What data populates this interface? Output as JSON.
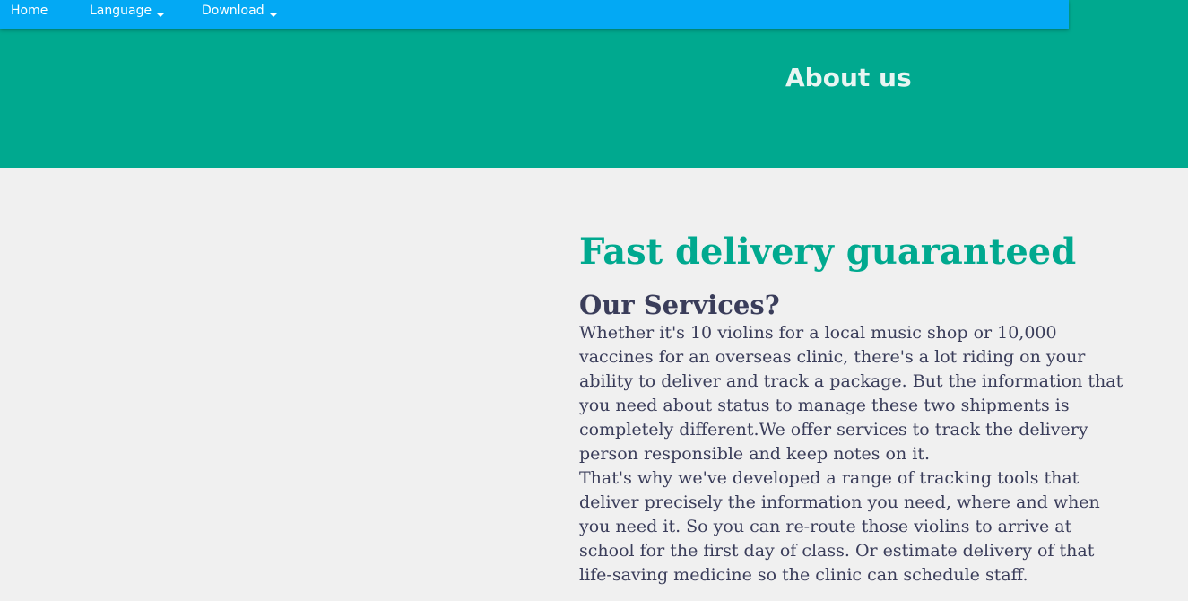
{
  "nav": {
    "home_label": "Home",
    "language_label": "Language",
    "download_label": "Download"
  },
  "hero": {
    "title": "About us"
  },
  "main": {
    "headline": "Fast delivery guaranteed",
    "subheading": "Our Services?",
    "paragraph_1": "Whether it's 10 violins for a local music shop or 10,000 vaccines for an overseas clinic, there's a lot riding on your ability to deliver and track a package. But the information that you need about status to manage these two shipments is completely different.We offer services to track the delivery person responsible and keep notes on it.",
    "paragraph_2": "That's why we've developed a range of tracking tools that deliver precisely the information you need, where and when you need it. So you can re-route those violins to arrive at school for the first day of class. Or estimate delivery of that life-saving medicine so the clinic can schedule staff."
  },
  "colors": {
    "navbar": "#03a9f4",
    "hero": "#00a98f",
    "accent": "#00a98f",
    "text": "#3a3d5a",
    "background": "#f0f0f0"
  },
  "icons": {
    "dropdown": "caret-down-icon"
  }
}
